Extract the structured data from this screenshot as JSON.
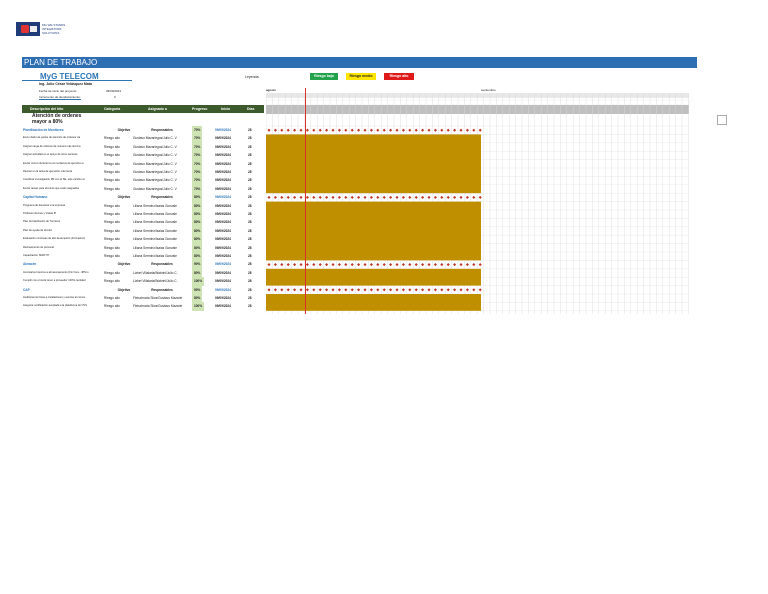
{
  "logo": {
    "text": "MG WE STANDS INTEGRATOR SOLUTIONS"
  },
  "title": "PLAN DE TRABAJO",
  "company": "MyG TELECOM",
  "manager": "Ing. Julio César Velásquez Mata",
  "header_fields": {
    "start_label": "Fecha de inicio del proyecto:",
    "start_value": "09/09/2024",
    "increment_label": "Incremento de desplazamiento:",
    "increment_value": "0"
  },
  "legend": {
    "label": "Leyenda:",
    "items": [
      {
        "label": "Riesgo bajo",
        "color": "#22a24a"
      },
      {
        "label": "Riesgo medio",
        "color": "#ffe500"
      },
      {
        "label": "Riesgo alto",
        "color": "#e0191b"
      }
    ]
  },
  "months": [
    "agosto",
    "septiembre"
  ],
  "columns": [
    "Descripción del hito",
    "Categoría",
    "Asignado a",
    "Progreso",
    "Inicio",
    "Días"
  ],
  "main_heading": "Atención de ordenes mayor a 80%",
  "rows": [
    {
      "type": "section",
      "name": "Planificación de Monitoreo",
      "cat": "Objetivo",
      "assigned": "Responsables",
      "pct": "70%",
      "start": "09/09/2024",
      "days": "28"
    },
    {
      "type": "task",
      "name": "Envío diario de partes de atención de ordenes vía",
      "cat": "Riesgo alto",
      "assigned": "Gustavo Mazariegos/Julio C. V",
      "pct": "70%",
      "start": "09/09/2024",
      "days": "28"
    },
    {
      "type": "task",
      "name": "Asignar carga de ordenes de manera más técnica",
      "cat": "Riesgo alto",
      "assigned": "Gustavo Mazariegos/Julio C. V",
      "pct": "70%",
      "start": "09/09/2024",
      "days": "28"
    },
    {
      "type": "task",
      "name": "Asignar actividad en el apoyo de otros sectores",
      "cat": "Riesgo alto",
      "assigned": "Gustavo Mazariegos/Julio C. V",
      "pct": "70%",
      "start": "09/09/2024",
      "days": "28"
    },
    {
      "type": "task",
      "name": "Enviar correo durante la con reclamos de ejecutivo a",
      "cat": "Riesgo alto",
      "assigned": "Gustavo Mazariegos/Julio C. V",
      "pct": "70%",
      "start": "09/09/2024",
      "days": "28"
    },
    {
      "type": "task",
      "name": "Revisar en la tarea de ejecución más lenta",
      "cat": "Riesgo alto",
      "assigned": "Gustavo Mazariegos/Julio C. V",
      "pct": "70%",
      "start": "09/09/2024",
      "days": "28"
    },
    {
      "type": "task",
      "name": "Coordinar investigación PR con el SE, este cambio al",
      "cat": "Riesgo alto",
      "assigned": "Gustavo Mazariegos/Julio C. V",
      "pct": "70%",
      "start": "09/09/2024",
      "days": "28"
    },
    {
      "type": "task",
      "name": "Enviar tareas para técnicos que están asignados",
      "cat": "Riesgo alto",
      "assigned": "Gustavo Mazariegos/Julio C. V",
      "pct": "70%",
      "start": "09/09/2024",
      "days": "28"
    },
    {
      "type": "section",
      "name": "Capital Humano",
      "cat": "Objetivo",
      "assigned": "Responsables",
      "pct": "80%",
      "start": "09/09/2024",
      "days": "28"
    },
    {
      "type": "task",
      "name": "Programa de bienestar a la empresa",
      "cat": "Riesgo alto",
      "assigned": "Liliana Sermino/Isaias Gonzale",
      "pct": "80%",
      "start": "09/09/2024",
      "days": "28"
    },
    {
      "type": "task",
      "name": "Políticas internas y Visitas IP",
      "cat": "Riesgo alto",
      "assigned": "Liliana Sermino/Isaias Gonzale",
      "pct": "80%",
      "start": "09/09/2024",
      "days": "28"
    },
    {
      "type": "task",
      "name": "Plan de fidelización de Técnicos",
      "cat": "Riesgo alto",
      "assigned": "Liliana Sermino/Isaias Gonzale",
      "pct": "80%",
      "start": "09/09/2024",
      "days": "28"
    },
    {
      "type": "task",
      "name": "Plan de ayuda de técnico",
      "cat": "Riesgo alto",
      "assigned": "Liliana Sermino/Isaias Gonzale",
      "pct": "80%",
      "start": "09/09/2024",
      "days": "28"
    },
    {
      "type": "task",
      "name": "Evaluación continuas de alto desempeño (Formación)",
      "cat": "Riesgo alto",
      "assigned": "Liliana Sermino/Isaias Gonzale",
      "pct": "80%",
      "start": "09/09/2024",
      "days": "28"
    },
    {
      "type": "task",
      "name": "Reclutamiento de personal",
      "cat": "Riesgo alto",
      "assigned": "Liliana Sermino/Isaias Gonzale",
      "pct": "80%",
      "start": "09/09/2024",
      "days": "28"
    },
    {
      "type": "task",
      "name": "Capacitación SMATYP",
      "cat": "Riesgo alto",
      "assigned": "Liliana Sermino/Isaias Gonzale",
      "pct": "80%",
      "start": "09/09/2024",
      "days": "28"
    },
    {
      "type": "section",
      "name": "Almacén",
      "cat": "Objetivo",
      "assigned": "Responsables",
      "pct": "90%",
      "start": "09/09/2024",
      "days": "28"
    },
    {
      "type": "task",
      "name": "Inventarios Internos a almacenamiento (Fin hora - 4PM o",
      "cat": "Riesgo alto",
      "assigned": "Lizbet Villalaria/Wabrini/Julio C.",
      "pct": "80%",
      "start": "09/09/2024",
      "days": "28"
    },
    {
      "type": "task",
      "name": "Cumplir con el stock tener a proveedor 100% cantidad",
      "cat": "Riesgo alto",
      "assigned": "Lizbet Villalaria/Wabrini/Julio C.",
      "pct": "100%",
      "start": "09/09/2024",
      "days": "28"
    },
    {
      "type": "section",
      "name": "CAP",
      "cat": "Objetivo",
      "assigned": "Responsables",
      "pct": "90%",
      "start": "09/09/2024",
      "days": "28"
    },
    {
      "type": "task",
      "name": "Auditorías técnicas a instalaciones y averías al menos",
      "cat": "Riesgo alto",
      "assigned": "Fleischrada Silva/Gustavo Mazarie",
      "pct": "80%",
      "start": "09/09/2024",
      "days": "28"
    },
    {
      "type": "task",
      "name": "Asegurar certificación aceptada a la plataforma de OVS",
      "cat": "Riesgo alto",
      "assigned": "Fleischrada Silva/Gustavo Mazarie",
      "pct": "100%",
      "start": "09/09/2024",
      "days": "28"
    }
  ],
  "colors": {
    "accent": "#2e6eb2",
    "header_green": "#3d5a2c",
    "bar_gold": "#bf8f00",
    "progress_bg": "#cfe4b4",
    "today_line": "#d9312b"
  }
}
